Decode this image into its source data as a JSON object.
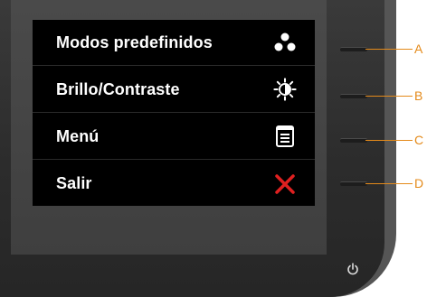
{
  "osd_menu": {
    "items": [
      {
        "label": "Modos predefinidos",
        "icon": "three-dots-icon",
        "button": "A"
      },
      {
        "label": "Brillo/Contraste",
        "icon": "brightness-contrast-icon",
        "button": "B"
      },
      {
        "label": "Menú",
        "icon": "menu-icon",
        "button": "C"
      },
      {
        "label": "Salir",
        "icon": "close-icon",
        "button": "D"
      }
    ]
  },
  "colors": {
    "callout": "#e48a1a",
    "exit_icon": "#e02020",
    "osd_background": "#000000"
  },
  "power_button": {
    "icon": "power-icon"
  }
}
